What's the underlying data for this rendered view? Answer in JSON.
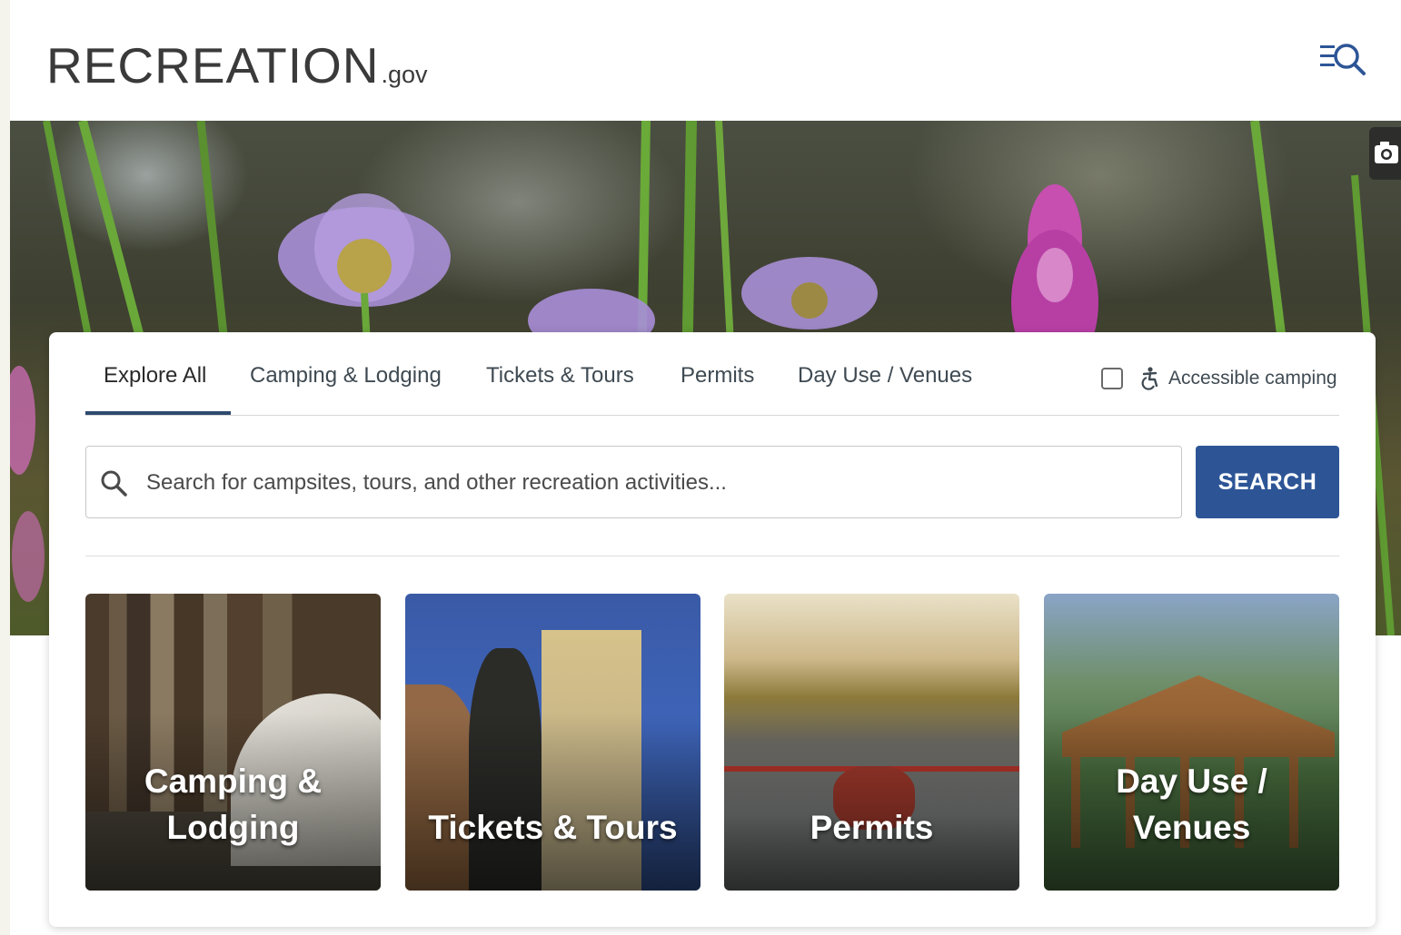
{
  "header": {
    "logo_text_main": "RECREATION",
    "logo_text_suffix": ".gov",
    "menu_icon": "menu-search-icon"
  },
  "hero": {
    "photo_icon": "camera-icon"
  },
  "tabs": [
    {
      "label": "Explore All",
      "active": true
    },
    {
      "label": "Camping & Lodging",
      "active": false
    },
    {
      "label": "Tickets & Tours",
      "active": false
    },
    {
      "label": "Permits",
      "active": false
    },
    {
      "label": "Day Use / Venues",
      "active": false
    }
  ],
  "accessible": {
    "label": "Accessible camping",
    "checked": false,
    "icon": "accessibility-icon"
  },
  "search": {
    "placeholder": "Search for campsites, tours, and other recreation activities...",
    "value": "",
    "button_label": "SEARCH",
    "icon": "search-icon"
  },
  "tiles": [
    {
      "label": "Camping & Lodging"
    },
    {
      "label": "Tickets & Tours"
    },
    {
      "label": "Permits"
    },
    {
      "label": "Day Use / Venues"
    }
  ],
  "colors": {
    "primary_blue": "#2d5596",
    "tab_underline": "#2d4a6e",
    "logo_green": "#4a7d2a"
  }
}
